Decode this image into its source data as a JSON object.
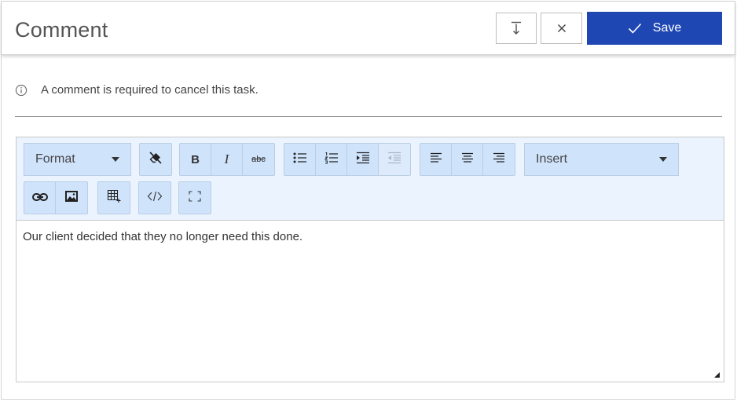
{
  "dialog": {
    "title": "Comment",
    "save_label": "Save"
  },
  "notice": {
    "text": "A comment is required to cancel this task."
  },
  "toolbar": {
    "format_label": "Format",
    "insert_label": "Insert",
    "bold_label": "B",
    "italic_label": "I",
    "strike_label": "abc"
  },
  "editor": {
    "content": "Our client decided that they no longer need this done."
  },
  "colors": {
    "save_bg": "#1f47b3",
    "toolbar_bg": "#eaf3fe",
    "button_bg": "#cfe3fb"
  }
}
